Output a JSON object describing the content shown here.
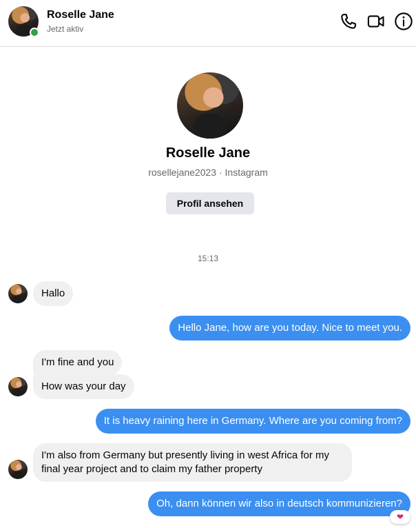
{
  "header": {
    "name": "Roselle Jane",
    "status": "Jetzt aktiv",
    "icons": [
      "phone-icon",
      "video-camera-icon",
      "info-icon"
    ]
  },
  "profile": {
    "name": "Roselle Jane",
    "subtitle": "rosellejane2023 · Instagram",
    "button_label": "Profil ansehen"
  },
  "conversation": {
    "timestamp": "15:13",
    "messages": [
      {
        "direction": "in",
        "text": "Hallo"
      },
      {
        "direction": "out",
        "text": "Hello Jane, how are you today. Nice to meet you."
      },
      {
        "direction": "in",
        "text": "I'm fine and you"
      },
      {
        "direction": "in",
        "text": "How was your day"
      },
      {
        "direction": "out",
        "text": "It is heavy raining here in Germany. Where are you coming from?"
      },
      {
        "direction": "in",
        "text": "I'm also from Germany but presently living in west Africa for my"
      },
      {
        "direction": "in",
        "text": "final year project and to claim my father property"
      },
      {
        "direction": "out",
        "text": "Oh, dann können wir also in deutsch kommunizieren?",
        "reaction": "❤"
      }
    ]
  },
  "colors": {
    "outgoing_bubble": "#3b8ff0",
    "incoming_bubble": "#f0f0f0",
    "online": "#31a24c"
  }
}
